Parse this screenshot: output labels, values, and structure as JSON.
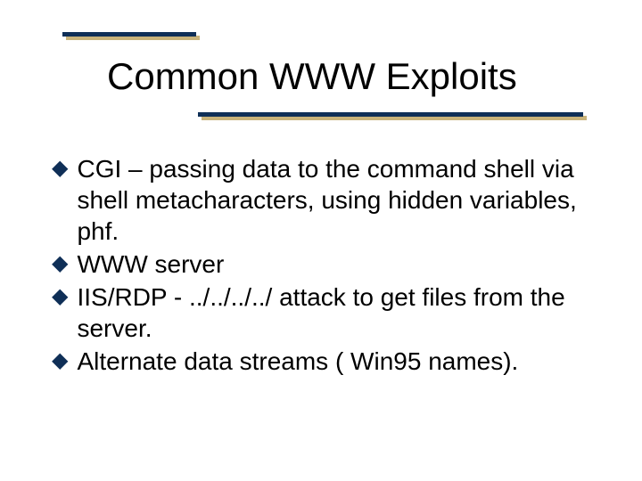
{
  "title": "Common WWW Exploits",
  "bullets": {
    "b0": "CGI – passing data to the command shell via shell metacharacters, using hidden variables, phf.",
    "b1": "WWW server",
    "b2": "IIS/RDP - ../../../../ attack to get files from the server.",
    "b3": "Alternate data streams ( Win95 names)."
  }
}
